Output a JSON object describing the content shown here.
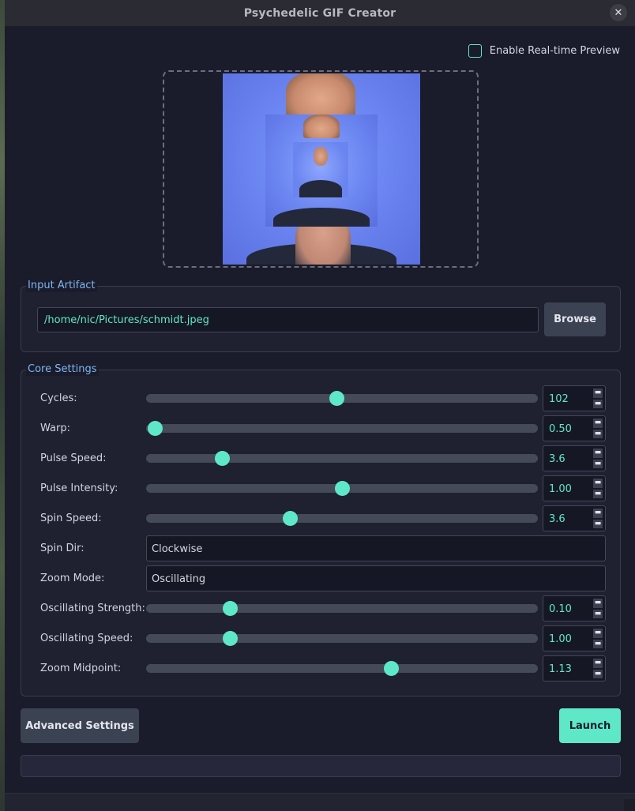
{
  "window": {
    "title": "Psychedelic GIF Creator"
  },
  "preview": {
    "toggle_label": "Enable Real-time Preview",
    "toggle_checked": false
  },
  "input_group": {
    "legend": "Input Artifact",
    "path_value": "/home/nic/Pictures/schmidt.jpeg",
    "browse_label": "Browse"
  },
  "core": {
    "legend": "Core Settings",
    "cycles": {
      "label": "Cycles:",
      "value": "102",
      "fraction": 0.486
    },
    "warp": {
      "label": "Warp:",
      "value": "0.50",
      "fraction": 0.022
    },
    "pulse_speed": {
      "label": "Pulse Speed:",
      "value": "3.6",
      "fraction": 0.193
    },
    "pulse_intensity": {
      "label": "Pulse Intensity:",
      "value": "1.00",
      "fraction": 0.5
    },
    "spin_speed": {
      "label": "Spin Speed:",
      "value": "3.6",
      "fraction": 0.367
    },
    "spin_dir": {
      "label": "Spin Dir:",
      "value": "Clockwise"
    },
    "zoom_mode": {
      "label": "Zoom Mode:",
      "value": "Oscillating"
    },
    "osc_strength": {
      "label": "Oscillating Strength:",
      "value": "0.10",
      "fraction": 0.214
    },
    "osc_speed": {
      "label": "Oscillating Speed:",
      "value": "1.00",
      "fraction": 0.214
    },
    "zoom_midpoint": {
      "label": "Zoom Midpoint:",
      "value": "1.13",
      "fraction": 0.625
    }
  },
  "actions": {
    "advanced_label": "Advanced Settings",
    "launch_label": "Launch"
  },
  "progress": {
    "fraction": 0
  },
  "colors": {
    "accent": "#5ee8c8",
    "legend": "#7fb7f2",
    "background": "#1a1b2b"
  }
}
